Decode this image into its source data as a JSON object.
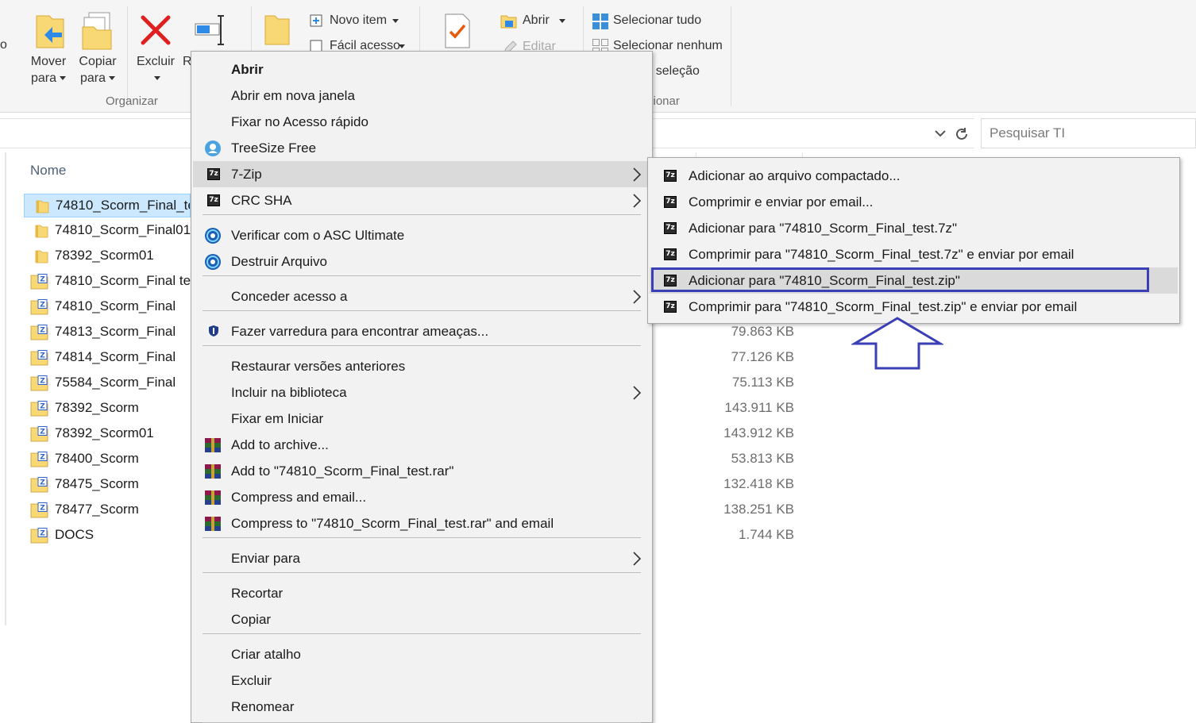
{
  "ribbon": {
    "clipboard_edge_text": "o",
    "move_to": {
      "line1": "Mover",
      "line2": "para"
    },
    "copy_to": {
      "line1": "Copiar",
      "line2": "para"
    },
    "delete": "Excluir",
    "rename_partial": "R",
    "organize_group": "Organizar",
    "new_item": "Novo item",
    "easy_access": "Fácil acesso",
    "open": "Abrir",
    "edit": "Editar",
    "select_all": "Selecionar tudo",
    "select_none": "Selecionar nenhum",
    "invert_selection_partial": "r seleção",
    "select_group_partial": "cionar"
  },
  "search": {
    "placeholder": "Pesquisar TI"
  },
  "file_list": {
    "column_name": "Nome",
    "items": [
      {
        "name": "74810_Scorm_Final_te",
        "type": "folder",
        "selected": true,
        "size": ""
      },
      {
        "name": "74810_Scorm_Final01",
        "type": "folder",
        "size": ""
      },
      {
        "name": "78392_Scorm01",
        "type": "folder",
        "size": ""
      },
      {
        "name": "74810_Scorm_Final te",
        "type": "zip",
        "size": ""
      },
      {
        "name": "74810_Scorm_Final",
        "type": "zip",
        "size": ""
      },
      {
        "name": "74813_Scorm_Final",
        "type": "zip",
        "size": "79.863 KB"
      },
      {
        "name": "74814_Scorm_Final",
        "type": "zip",
        "size": "77.126 KB"
      },
      {
        "name": "75584_Scorm_Final",
        "type": "zip",
        "size": "75.113 KB"
      },
      {
        "name": "78392_Scorm",
        "type": "zip",
        "size": "143.911 KB"
      },
      {
        "name": "78392_Scorm01",
        "type": "zip",
        "size": "143.912 KB"
      },
      {
        "name": "78400_Scorm",
        "type": "zip",
        "size": "53.813 KB"
      },
      {
        "name": "78475_Scorm",
        "type": "zip",
        "size": "132.418 KB"
      },
      {
        "name": "78477_Scorm",
        "type": "zip",
        "size": "138.251 KB"
      },
      {
        "name": "DOCS",
        "type": "zip",
        "size": "1.744 KB"
      }
    ]
  },
  "context_menu": {
    "items": [
      {
        "label": "Abrir"
      },
      {
        "label": "Abrir em nova janela"
      },
      {
        "label": "Fixar no Acesso rápido"
      },
      {
        "label": "TreeSize Free",
        "icon": "treesize-icon"
      },
      {
        "label": "7-Zip",
        "icon": "7zip-icon"
      },
      {
        "label": "CRC SHA",
        "icon": "7zip-icon"
      },
      {
        "label": "Verificar com o ASC Ultimate",
        "icon": "asc-icon"
      },
      {
        "label": "Destruir Arquivo",
        "icon": "asc-icon"
      },
      {
        "label": "Conceder acesso a"
      },
      {
        "label": "Fazer varredura para encontrar ameaças...",
        "icon": "defender-shield-icon"
      },
      {
        "label": "Restaurar versões anteriores"
      },
      {
        "label": "Incluir na biblioteca"
      },
      {
        "label": "Fixar em Iniciar"
      },
      {
        "label": "Add to archive...",
        "icon": "winrar-icon"
      },
      {
        "label": "Add to \"74810_Scorm_Final_test.rar\"",
        "icon": "winrar-icon"
      },
      {
        "label": "Compress and email...",
        "icon": "winrar-icon"
      },
      {
        "label": "Compress to \"74810_Scorm_Final_test.rar\" and email",
        "icon": "winrar-icon"
      },
      {
        "label": "Enviar para"
      },
      {
        "label": "Recortar"
      },
      {
        "label": "Copiar"
      },
      {
        "label": "Criar atalho"
      },
      {
        "label": "Excluir"
      },
      {
        "label": "Renomear"
      }
    ]
  },
  "submenu_7zip": {
    "items": [
      {
        "label": "Adicionar ao arquivo compactado..."
      },
      {
        "label": "Comprimir e enviar por email..."
      },
      {
        "label": "Adicionar para \"74810_Scorm_Final_test.7z\""
      },
      {
        "label": "Comprimir para \"74810_Scorm_Final_test.7z\" e enviar por email"
      },
      {
        "label": "Adicionar para \"74810_Scorm_Final_test.zip\""
      },
      {
        "label": "Comprimir para \"74810_Scorm_Final_test.zip\" e enviar por email"
      }
    ],
    "icon_text": "7z"
  },
  "colors": {
    "highlight_box": "#3a3fb5",
    "menu_bg": "#f2f2f2",
    "menu_hover": "#dadada",
    "selection_bg": "#cce8ff"
  }
}
